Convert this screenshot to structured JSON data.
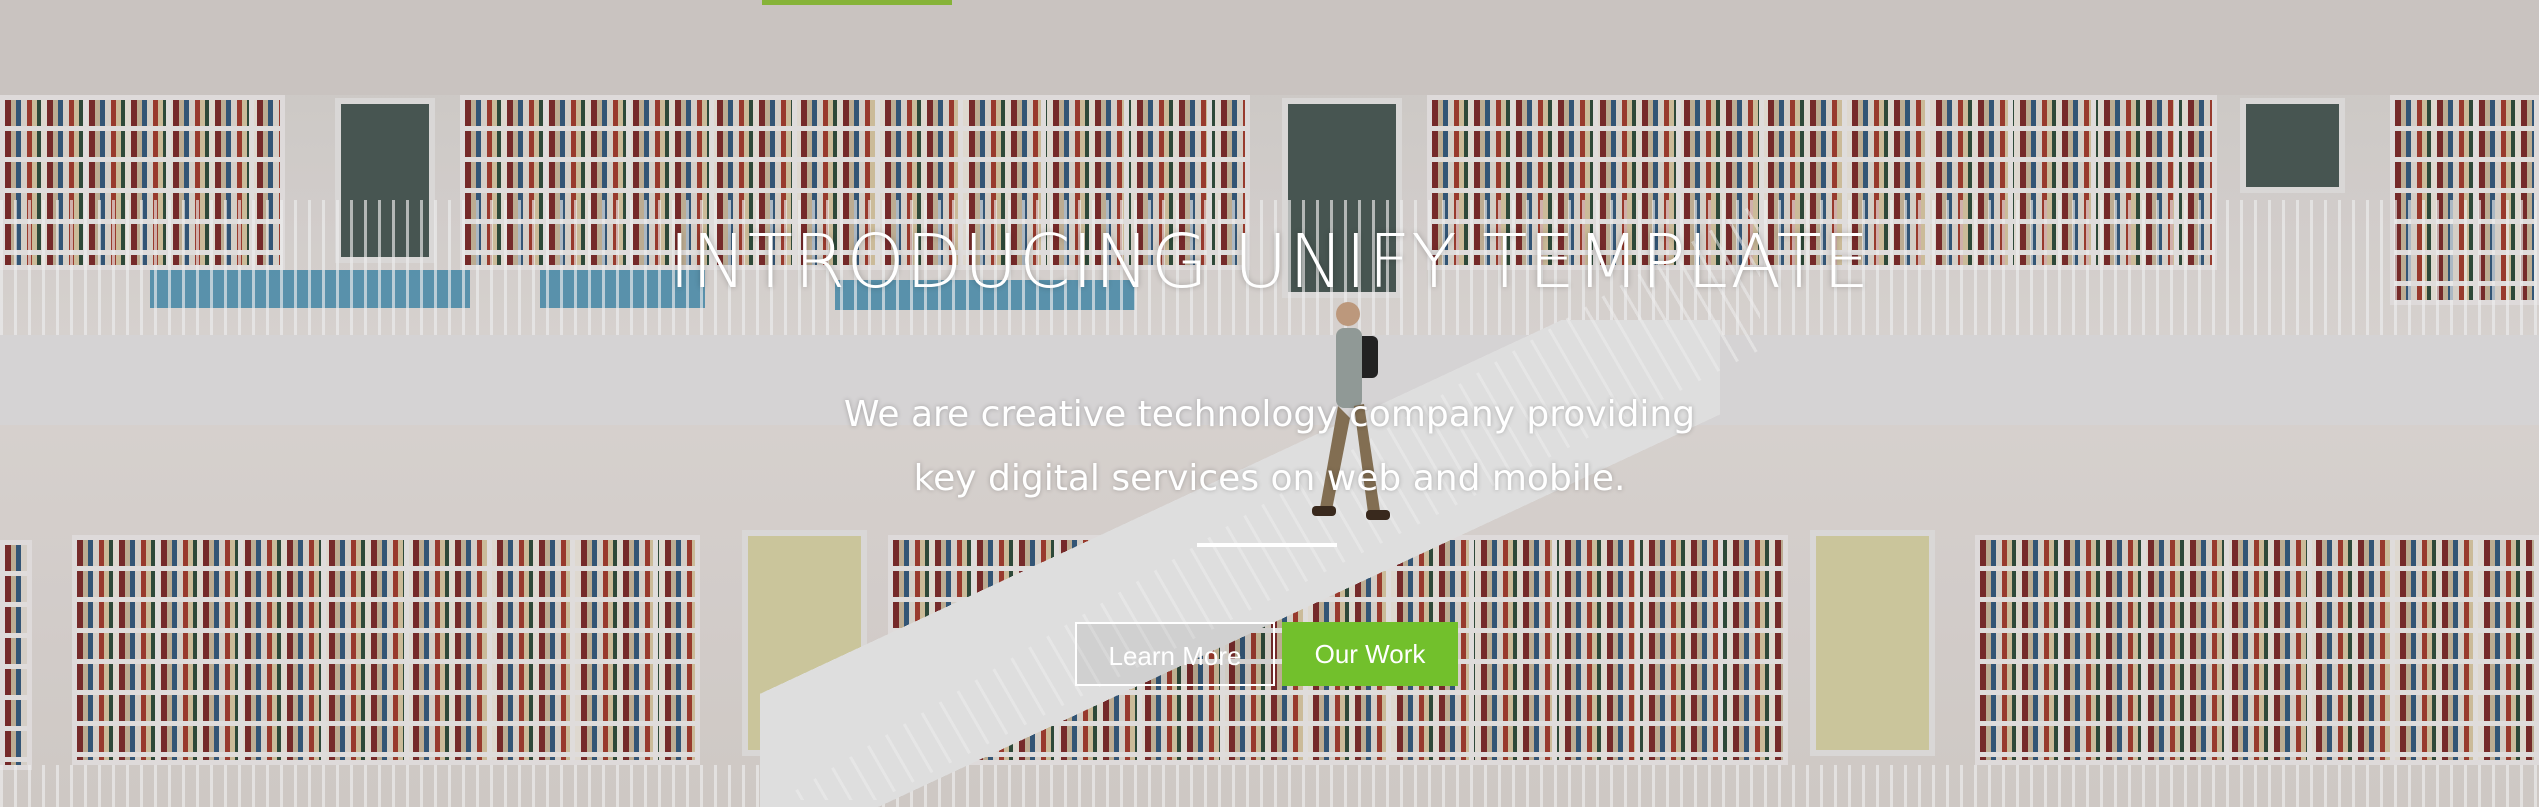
{
  "hero": {
    "title": "INTRODUCING UNIFY TEMPLATE",
    "subtitle_line1": "We are creative technology company providing",
    "subtitle_line2": "key digital services on web and mobile.",
    "buttons": {
      "learn_more": "Learn More",
      "our_work": "Our Work"
    }
  },
  "colors": {
    "accent_green": "#72c02c",
    "text": "#ffffff"
  }
}
